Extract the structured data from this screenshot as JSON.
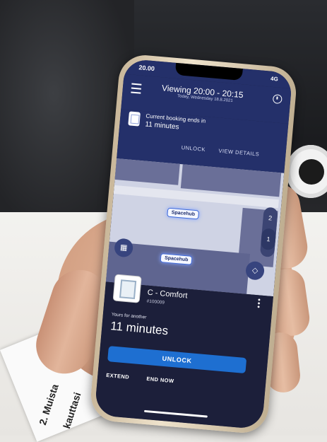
{
  "status_bar": {
    "time": "20.00",
    "network": "4G"
  },
  "header": {
    "title": "Viewing 20:00 - 20:15",
    "subtitle": "Today, Wednesday 18.8.2021"
  },
  "booking": {
    "line1": "Current booking ends in",
    "line2": "11 minutes",
    "actions": [
      "UNLOCK",
      "VIEW DETAILS"
    ]
  },
  "map": {
    "spacehub_labels": [
      "Spacehub",
      "Spacehub"
    ],
    "floors": [
      "2",
      "1"
    ],
    "selected_floor": "1"
  },
  "room": {
    "name": "C - Comfort",
    "id": "#100009",
    "yours_label": "Yours for another",
    "remaining": "11 minutes",
    "unlock_label": "UNLOCK",
    "extend_label": "EXTEND",
    "end_label": "END NOW"
  },
  "paper": {
    "line1": "2. Muista",
    "line2": "kauttasi"
  },
  "colors": {
    "header": "#24306a",
    "sheet": "#1c1f3a",
    "unlock_button": "#1e6fd1",
    "map_room": "#6a6f98"
  }
}
